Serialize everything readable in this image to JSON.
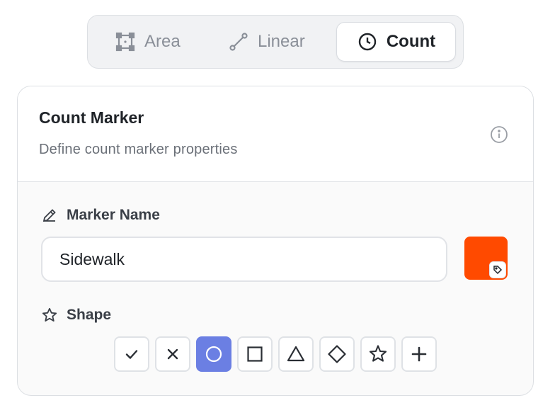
{
  "tabs": [
    {
      "label": "Area",
      "icon": "area-icon",
      "active": false
    },
    {
      "label": "Linear",
      "icon": "linear-icon",
      "active": false
    },
    {
      "label": "Count",
      "icon": "clock-icon",
      "active": true
    }
  ],
  "card": {
    "title": "Count Marker",
    "subtitle": "Define count marker properties",
    "info_icon": "info-icon"
  },
  "marker_name": {
    "label": "Marker Name",
    "icon": "pencil-icon",
    "value": "Sidewalk",
    "color": "#ff4a00"
  },
  "shape": {
    "label": "Shape",
    "icon": "star-outline-icon",
    "options": [
      "check",
      "cross",
      "circle",
      "square",
      "triangle",
      "diamond",
      "star",
      "plus"
    ],
    "selected": "circle"
  },
  "colors": {
    "accent": "#6b7fe3",
    "marker": "#ff4a00"
  }
}
